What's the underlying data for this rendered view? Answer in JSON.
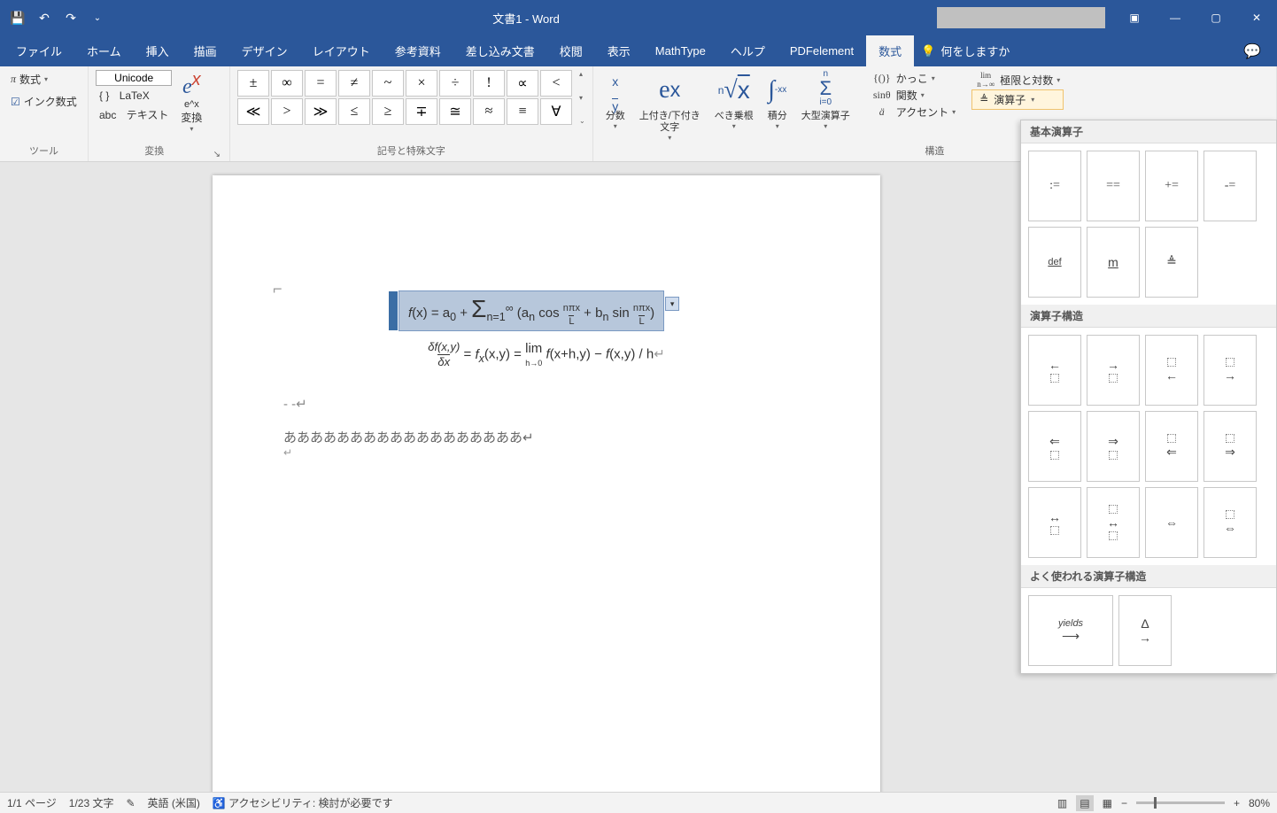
{
  "title": "文書1 - Word",
  "qat": {
    "save": "save",
    "undo": "undo",
    "redo": "redo"
  },
  "tabs": [
    "ファイル",
    "ホーム",
    "挿入",
    "描画",
    "デザイン",
    "レイアウト",
    "参考資料",
    "差し込み文書",
    "校閲",
    "表示",
    "MathType",
    "ヘルプ",
    "PDFelement",
    "数式"
  ],
  "active_tab_index": 13,
  "tell_me": "何をしますか",
  "ribbon": {
    "tools": {
      "equation": "数式",
      "ink": "インク数式",
      "label": "ツール"
    },
    "conversion": {
      "unicode": "Unicode",
      "latex": "LaTeX",
      "text": "テキスト",
      "ex": "e^x",
      "convert": "変換",
      "abc": "abc",
      "braces": "{ }",
      "label": "変換"
    },
    "symbols": {
      "row1": [
        "±",
        "∞",
        "=",
        "≠",
        "~",
        "×",
        "÷",
        "!",
        "∝",
        "<"
      ],
      "row2": [
        "≪",
        ">",
        "≫",
        "≤",
        "≥",
        "∓",
        "≅",
        "≈",
        "≡",
        "∀"
      ],
      "label": "記号と特殊文字"
    },
    "structures": {
      "items": [
        {
          "icon": "x/y",
          "label": "分数"
        },
        {
          "icon": "eˣ",
          "label": "上付き/下付き\n文字"
        },
        {
          "icon": "ⁿ√x",
          "label": "べき乗根"
        },
        {
          "icon": "∫",
          "label": "積分"
        },
        {
          "icon": "Σ",
          "label": "大型演算子"
        }
      ],
      "brackets": "かっこ",
      "functions": "関数",
      "accents": "アクセント",
      "limits": "極限と対数",
      "operator": "演算子",
      "label": "構造"
    }
  },
  "gallery": {
    "section1": "基本演算子",
    "basic": [
      ":=",
      "==",
      "+=",
      "-=",
      "def",
      "m",
      "≜"
    ],
    "section2": "演算子構造",
    "section3": "よく使われる演算子構造",
    "yields_label": "yields"
  },
  "document": {
    "eq1": "f(x) = a₀ + Σₙ₌₁^∞ (aₙ cos(nπx/L) + bₙ sin(nπx/L))",
    "eq2": "δf(x,y)/δx = fₓ(x,y) = lim_{h→0} f(x+h,y) − f(x,y) / h",
    "dashes": "- -↵",
    "hiragana": "ああああああああああああああああああ↵"
  },
  "status": {
    "page": "1/1 ページ",
    "words": "1/23 文字",
    "lang": "英語 (米国)",
    "a11y": "アクセシビリティ: 検討が必要です",
    "zoom": "80%"
  }
}
